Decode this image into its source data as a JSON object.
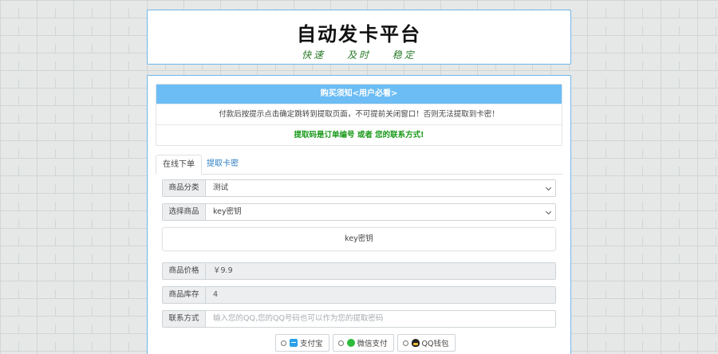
{
  "header": {
    "title": "自动发卡平台",
    "slogan": "快速 及时 稳定"
  },
  "notice": {
    "heading": "购买须知<用户必看>",
    "warning": "付款后按提示点击确定跳转到提取页面，不可提前关闭窗口！否则无法提取到卡密！",
    "hint": "提取码是订单编号 或者 您的联系方式!"
  },
  "tabs": [
    {
      "label": "在线下单",
      "active": true
    },
    {
      "label": "提取卡密",
      "active": false
    }
  ],
  "form": {
    "category": {
      "label": "商品分类",
      "value": "测试"
    },
    "product": {
      "label": "选择商品",
      "value": "key密钥"
    },
    "description": "key密钥",
    "price": {
      "label": "商品价格",
      "value": "￥9.9"
    },
    "stock": {
      "label": "商品库存",
      "value": "4"
    },
    "contact": {
      "label": "联系方式",
      "placeholder": "输入您的QQ,您的QQ号码也可以作为您的提取密码"
    }
  },
  "payment": {
    "alipay": "支付宝",
    "wechat": "微信支付",
    "qq": "QQ钱包"
  },
  "colors": {
    "accent": "#6cbdf5",
    "border": "#6fb6e8",
    "green_text": "#1a9a1a",
    "link": "#2d7fc4"
  }
}
